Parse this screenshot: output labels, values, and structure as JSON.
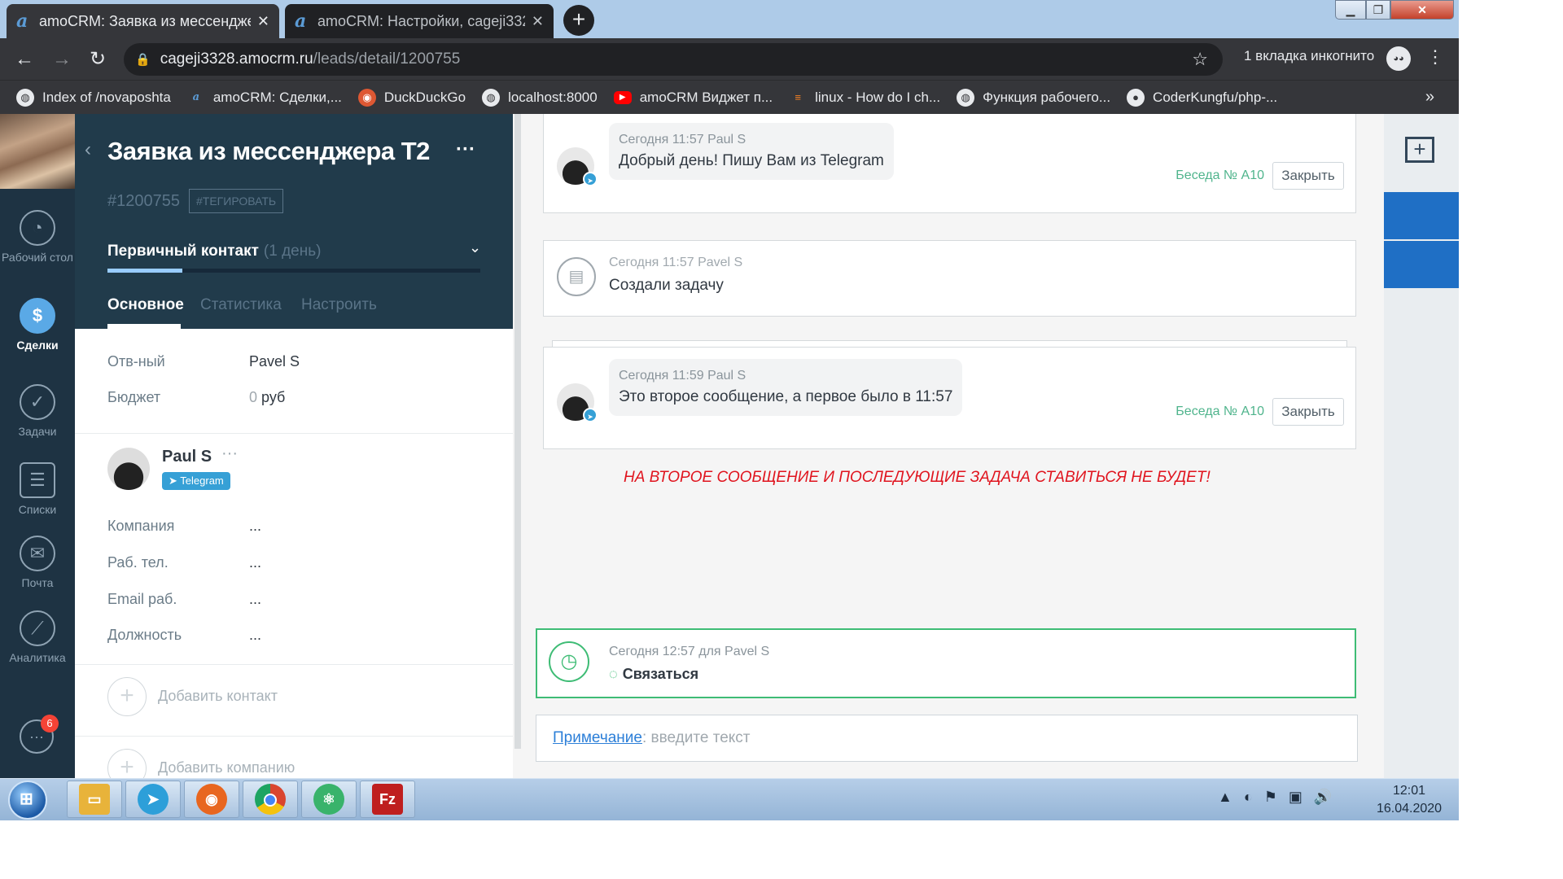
{
  "browser": {
    "tabs": [
      {
        "title": "amoCRM: Заявка из мессендже",
        "active": true
      },
      {
        "title": "amoCRM: Настройки, cageji3328",
        "active": false
      }
    ],
    "url_host": "cageji3328.amocrm.ru",
    "url_path": "/leads/detail/1200755",
    "incognito_label": "1 вкладка инкогнито",
    "bookmarks": [
      {
        "label": "Index of /novaposhta",
        "icon": "globe-icon"
      },
      {
        "label": "amoCRM: Сделки,...",
        "icon": "amocrm-icon"
      },
      {
        "label": "DuckDuckGo",
        "icon": "duckduckgo-icon"
      },
      {
        "label": "localhost:8000",
        "icon": "globe-icon"
      },
      {
        "label": "amoCRM Виджет п...",
        "icon": "youtube-icon"
      },
      {
        "label": "linux - How do I ch...",
        "icon": "stackoverflow-icon"
      },
      {
        "label": "Функция рабочего...",
        "icon": "globe-icon"
      },
      {
        "label": "CoderKungfu/php-...",
        "icon": "github-icon"
      }
    ],
    "bookmarks_more": "»"
  },
  "leftnav": {
    "items": [
      {
        "label": "Рабочий стол",
        "icon": "dashboard-icon"
      },
      {
        "label": "Сделки",
        "icon": "deals-icon",
        "active": true
      },
      {
        "label": "Задачи",
        "icon": "tasks-icon"
      },
      {
        "label": "Списки",
        "icon": "lists-icon"
      },
      {
        "label": "Почта",
        "icon": "mail-icon"
      },
      {
        "label": "Аналитика",
        "icon": "analytics-icon"
      }
    ],
    "chat_badge": "6"
  },
  "card": {
    "title": "Заявка из мессенджера Т2",
    "lead_id": "#1200755",
    "tag_button": "#ТЕГИРОВАТЬ",
    "stage": "Первичный контакт",
    "stage_days": "(1 день)",
    "stage_progress": 0.2,
    "tabs": [
      "Основное",
      "Статистика",
      "Настроить"
    ],
    "fields": [
      {
        "label": "Отв-ный",
        "value": "Pavel S"
      },
      {
        "label": "Бюджет",
        "value_num": "0",
        "value_unit": "руб"
      }
    ],
    "contact": {
      "name": "Paul S",
      "channel": "Telegram",
      "fields": [
        {
          "label": "Компания",
          "value": "..."
        },
        {
          "label": "Раб. тел.",
          "value": "..."
        },
        {
          "label": "Email раб.",
          "value": "..."
        },
        {
          "label": "Должность",
          "value": "..."
        }
      ]
    },
    "add_contact": "Добавить контакт",
    "add_company": "Добавить компанию"
  },
  "feed": {
    "messages": [
      {
        "meta": "Сегодня 11:57 Paul S",
        "text": "Добрый день! Пишу Вам из Telegram",
        "conversation": "Беседа № A10",
        "close_label": "Закрыть"
      },
      {
        "meta": "Сегодня 11:59 Paul S",
        "text": "Это второе сообщение, а первое было в 11:57",
        "conversation": "Беседа № A10",
        "close_label": "Закрыть"
      }
    ],
    "system_note": {
      "meta": "Сегодня 11:57 Pavel S",
      "text": "Создали задачу"
    },
    "warning": "НА ВТОРОЕ СООБЩЕНИЕ И ПОСЛЕДУЮЩИЕ ЗАДАЧА СТАВИТЬСЯ НЕ БУДЕТ!",
    "task": {
      "meta": "Сегодня 12:57 для Pavel S",
      "title": "Связаться"
    },
    "note_input": {
      "link": "Примечание",
      "placeholder": ": введите текст"
    }
  },
  "taskbar": {
    "apps": [
      {
        "name": "explorer",
        "icon": "folder-icon",
        "color": "#e8b33a"
      },
      {
        "name": "telegram",
        "icon": "telegram-icon",
        "color": "#2d9fd9"
      },
      {
        "name": "firefox",
        "icon": "firefox-icon",
        "color": "#e8661f"
      },
      {
        "name": "chrome",
        "icon": "chrome-icon",
        "color": "#d9452f"
      },
      {
        "name": "atom",
        "icon": "atom-icon",
        "color": "#39b36b"
      },
      {
        "name": "filezilla",
        "icon": "filezilla-icon",
        "color": "#bf1f1f"
      }
    ],
    "time": "12:01",
    "date": "16.04.2020"
  }
}
